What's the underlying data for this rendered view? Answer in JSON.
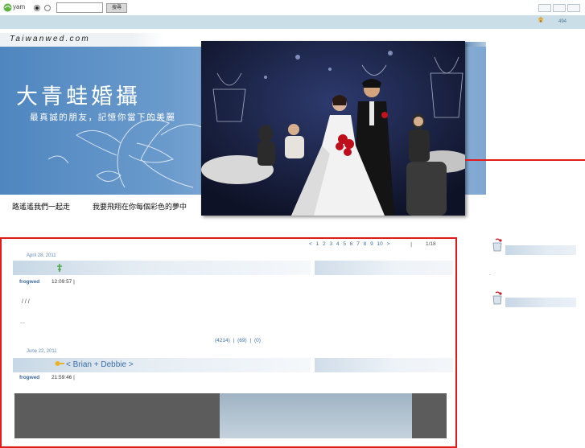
{
  "topbar": {
    "brand": "yam",
    "search_placeholder": "",
    "search_button": "搜尋"
  },
  "strip": {
    "count": "494"
  },
  "banner": {
    "site_url": "Taiwanwed.com",
    "title": "大青蛙婚攝",
    "subtitle": "最真誠的朋友，記憶你當下的美麗",
    "slogan_1": "路遙遙我們一起走",
    "slogan_2": "我要飛翔在你每個彩色的夢中"
  },
  "pager": {
    "prev": "< 1",
    "pages": [
      "2",
      "3",
      "4",
      "5",
      "6",
      "7",
      "8",
      "9",
      "10"
    ],
    "next": ">",
    "sep": "|",
    "total": "1/18"
  },
  "posts": [
    {
      "date": "April 28, 2011",
      "author": "frogwed",
      "time": "12:09:57 |",
      "lines": [
        "/      /      /",
        "..."
      ],
      "links": "(4214) |    (69) |    (0)"
    },
    {
      "date": "June 22, 2011",
      "title": "< Brian + Debbie >",
      "author": "frogwed",
      "time": "21:59:46 |"
    }
  ],
  "sidebar": {
    "dot": "."
  },
  "colors": {
    "accent_red": "#e21a1a",
    "link_blue": "#3b6ea5",
    "banner_blue": "#4f86bf"
  }
}
